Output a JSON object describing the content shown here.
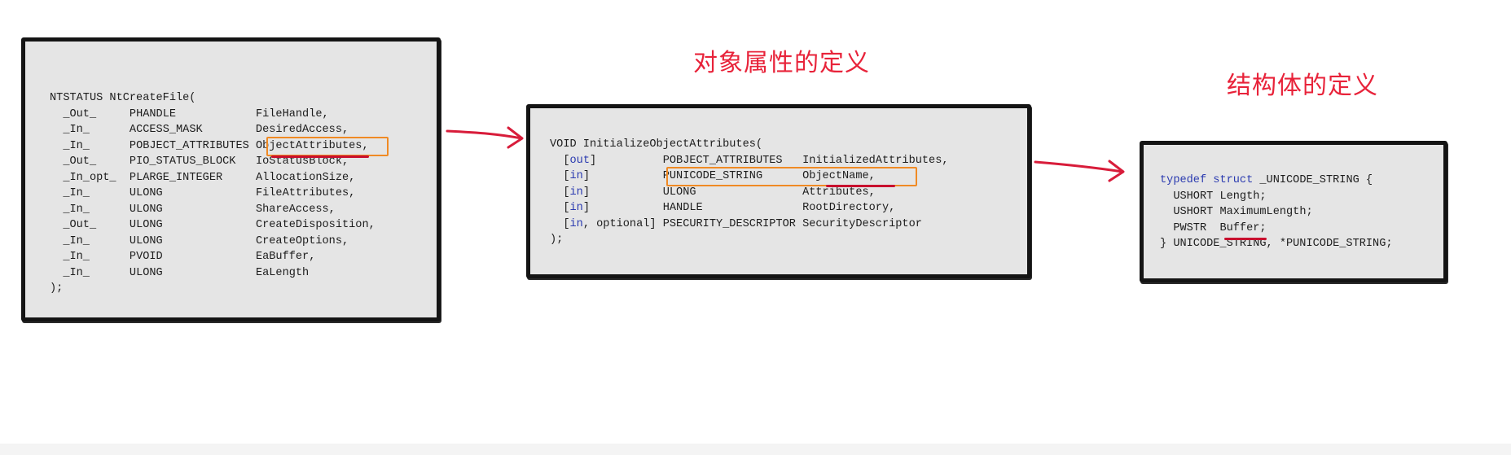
{
  "captions": {
    "object_attributes": "对象属性的定义",
    "struct_definition": "结构体的定义"
  },
  "ntcreatefile": {
    "header": "NTSTATUS NtCreateFile(",
    "params": [
      {
        "ann": "_Out_",
        "type": "PHANDLE",
        "name": "FileHandle,"
      },
      {
        "ann": "_In_",
        "type": "ACCESS_MASK",
        "name": "DesiredAccess,"
      },
      {
        "ann": "_In_",
        "type": "POBJECT_ATTRIBUTES",
        "name": "ObjectAttributes,"
      },
      {
        "ann": "_Out_",
        "type": "PIO_STATUS_BLOCK",
        "name": "IoStatusBlock,"
      },
      {
        "ann": "_In_opt_",
        "type": "PLARGE_INTEGER",
        "name": "AllocationSize,"
      },
      {
        "ann": "_In_",
        "type": "ULONG",
        "name": "FileAttributes,"
      },
      {
        "ann": "_In_",
        "type": "ULONG",
        "name": "ShareAccess,"
      },
      {
        "ann": "_Out_",
        "type": "ULONG",
        "name": "CreateDisposition,"
      },
      {
        "ann": "_In_",
        "type": "ULONG",
        "name": "CreateOptions,"
      },
      {
        "ann": "_In_",
        "type": "PVOID",
        "name": "EaBuffer,"
      },
      {
        "ann": "_In_",
        "type": "ULONG",
        "name": "EaLength"
      }
    ],
    "footer": ");"
  },
  "initobj": {
    "header": "VOID InitializeObjectAttributes(",
    "params": [
      {
        "pre": "[",
        "kw": "out",
        "post": "]",
        "type": "POBJECT_ATTRIBUTES",
        "name": "InitializedAttributes,"
      },
      {
        "pre": "[",
        "kw": "in",
        "post": "]",
        "type": "PUNICODE_STRING",
        "name": "ObjectName,"
      },
      {
        "pre": "[",
        "kw": "in",
        "post": "]",
        "type": "ULONG",
        "name": "Attributes,"
      },
      {
        "pre": "[",
        "kw": "in",
        "post": "]",
        "type": "HANDLE",
        "name": "RootDirectory,"
      },
      {
        "pre": "[",
        "kw": "in",
        "post": ", optional]",
        "type": "PSECURITY_DESCRIPTOR",
        "name": "SecurityDescriptor"
      }
    ],
    "footer": ");"
  },
  "unicode_struct": {
    "kw_typedef": "typedef",
    "kw_struct": "struct",
    "header_rest": " _UNICODE_STRING {",
    "fields": [
      {
        "type": "USHORT",
        "name": "Length;"
      },
      {
        "type": "USHORT",
        "name": "MaximumLength;"
      },
      {
        "type": "PWSTR",
        "name": "Buffer;"
      }
    ],
    "footer": "} UNICODE_STRING, *PUNICODE_STRING;"
  },
  "colors": {
    "caption": "#e8233a",
    "highlight_box": "#f08a24",
    "underline": "#c8102e",
    "keyword": "#2b3bb0",
    "card_bg": "#e5e5e5",
    "card_border": "#141414"
  }
}
